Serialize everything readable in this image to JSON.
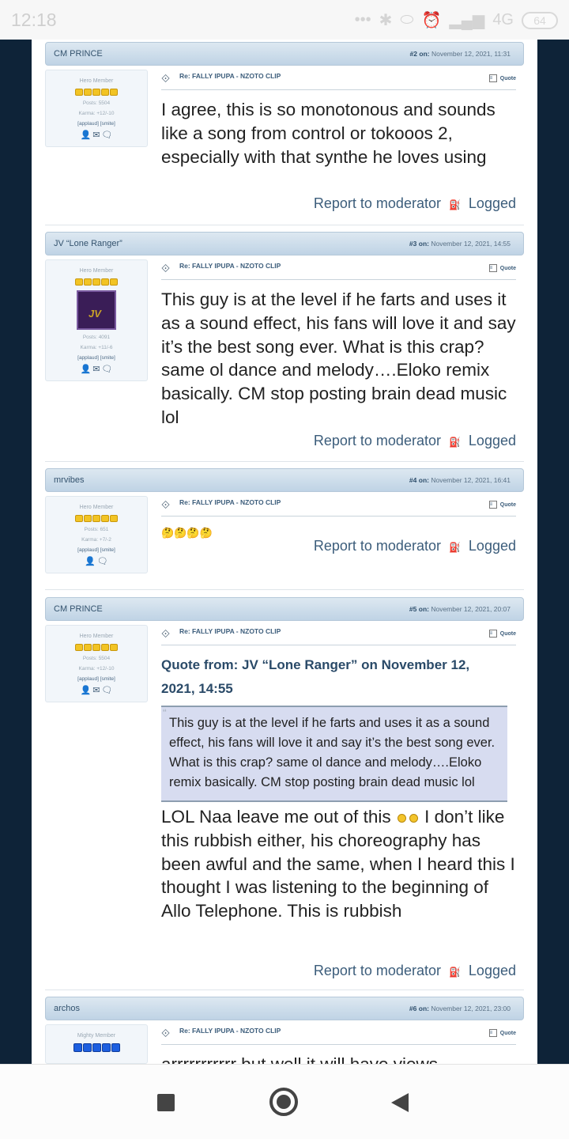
{
  "status_bar": {
    "time": "12:18",
    "network": "4G",
    "battery": "64"
  },
  "thread": {
    "subject": "Re: FALLY IPUPA - NZOTO CLIP",
    "quote_label": "Quote",
    "report_label": "Report to moderator",
    "logged_label": "Logged",
    "on_label": "on:",
    "applaud_smite": "[applaud] [smite]"
  },
  "posts": [
    {
      "author": "CM PRINCE",
      "number": "#2",
      "date": "November 12, 2021, 11:31",
      "rank": "Hero Member",
      "posts": "Posts: 5504",
      "karma": "Karma: +12/-10",
      "body": "I agree, this is so monotonous and sounds like a song from control or tokooos 2, especially with that synthe he loves using"
    },
    {
      "author": "JV “Lone Ranger”",
      "number": "#3",
      "date": "November 12, 2021, 14:55",
      "rank": "Hero Member",
      "posts": "Posts: 4091",
      "karma": "Karma: +11/-6",
      "body": "This guy is at the level if he farts and uses it as a sound effect, his fans will love it and say it’s the best song ever. What is this crap? same ol dance and melody….Eloko remix basically. CM stop posting brain dead music lol"
    },
    {
      "author": "mrvibes",
      "number": "#4",
      "date": "November 12, 2021, 16:41",
      "rank": "Hero Member",
      "posts": "Posts: 651",
      "karma": "Karma: +7/-2",
      "body": "🤔🤔🤔🤔"
    },
    {
      "author": "CM PRINCE",
      "number": "#5",
      "date": "November 12, 2021, 20:07",
      "rank": "Hero Member",
      "posts": "Posts: 5504",
      "karma": "Karma: +12/-10",
      "quote_from": "Quote from: JV “Lone Ranger” on November 12, 2021, 14:55",
      "quote_text": "This guy is at the level if he farts and uses it as a sound effect, his fans will love it and say it’s the best song ever. What is this crap? same ol dance and melody….Eloko remix basically. CM stop posting brain dead music lol",
      "body_part1": "LOL Naa leave me out of this",
      "body_part2": "I don’t like this rubbish either, his choreography has been awful and the same, when I heard this I thought I was listening to the beginning of Allo Telephone. This is rubbish"
    },
    {
      "author": "archos",
      "number": "#6",
      "date": "November 12, 2021, 23:00",
      "rank": "Mighty Member",
      "body": "arrrrrrrrrrr but well it will have views"
    }
  ]
}
